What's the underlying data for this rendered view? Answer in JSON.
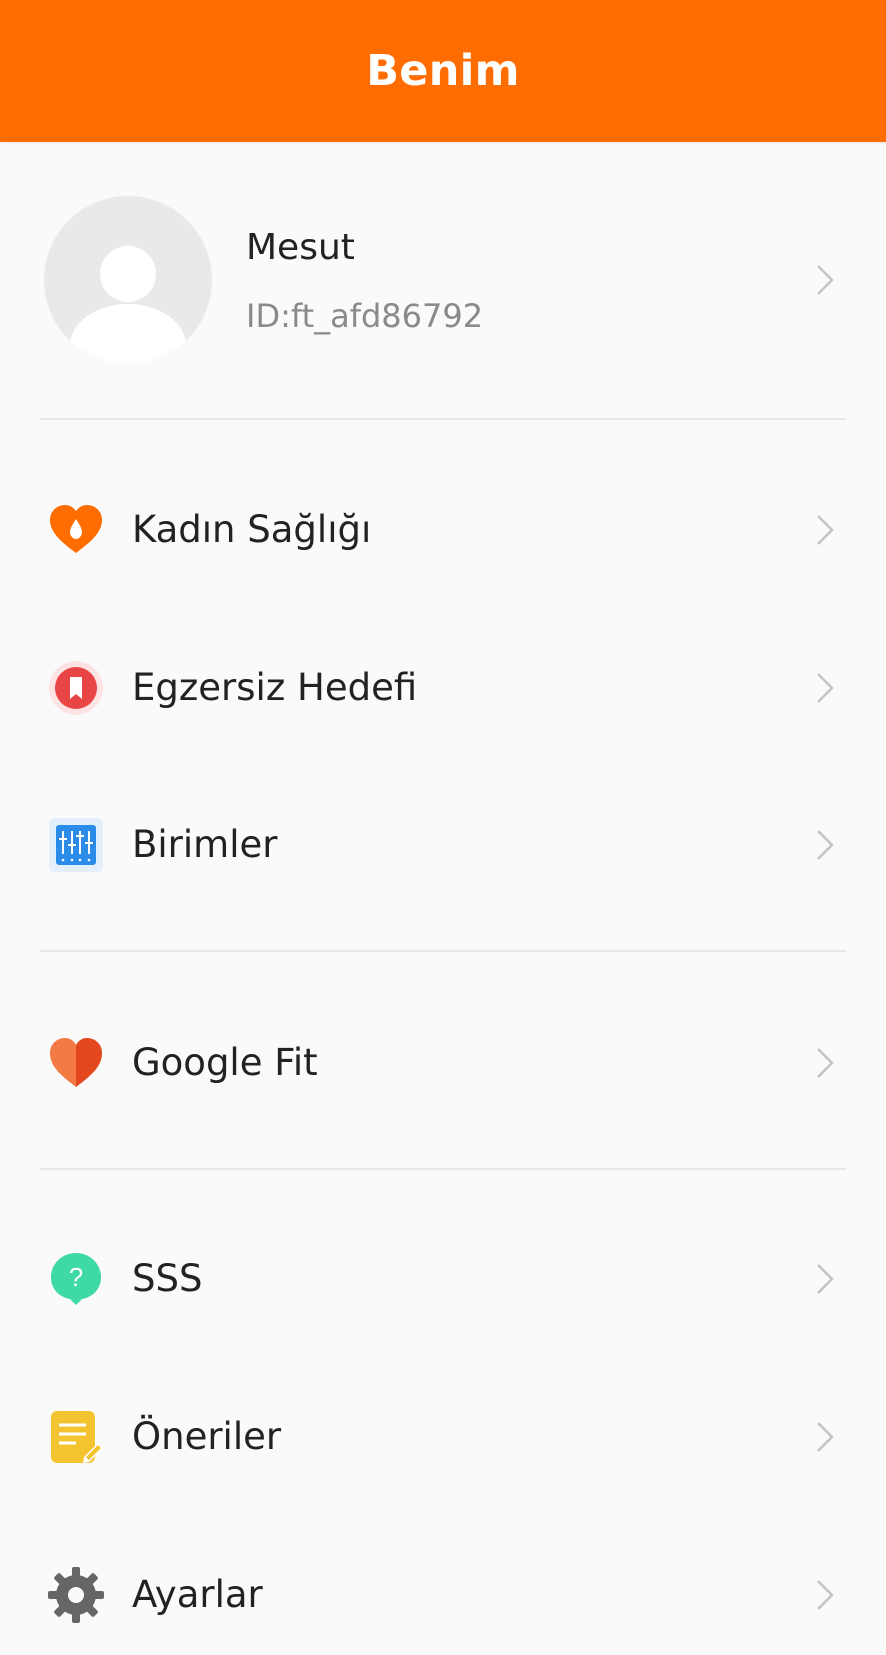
{
  "header": {
    "title": "Benim"
  },
  "profile": {
    "name": "Mesut",
    "id": "ID:ft_afd86792"
  },
  "menu": {
    "womens_health": {
      "label": "Kadın Sağlığı",
      "icon": "drop-heart-icon",
      "color": "#ff6d00"
    },
    "exercise_goal": {
      "label": "Egzersiz Hedefi",
      "icon": "bookmark-icon",
      "color": "#e84545"
    },
    "units": {
      "label": "Birimler",
      "icon": "sliders-icon",
      "color": "#2b8be8"
    },
    "google_fit": {
      "label": "Google Fit",
      "icon": "heart-icon",
      "color": "#f0552a"
    },
    "faq": {
      "label": "SSS",
      "icon": "question-icon",
      "color": "#3fd9a4"
    },
    "suggestions": {
      "label": "Öneriler",
      "icon": "note-icon",
      "color": "#f4c430"
    },
    "settings": {
      "label": "Ayarlar",
      "icon": "gear-icon",
      "color": "#666666"
    }
  },
  "colors": {
    "accent": "#ff6d00",
    "background": "#fafafa",
    "divider": "#e8e8e8"
  }
}
